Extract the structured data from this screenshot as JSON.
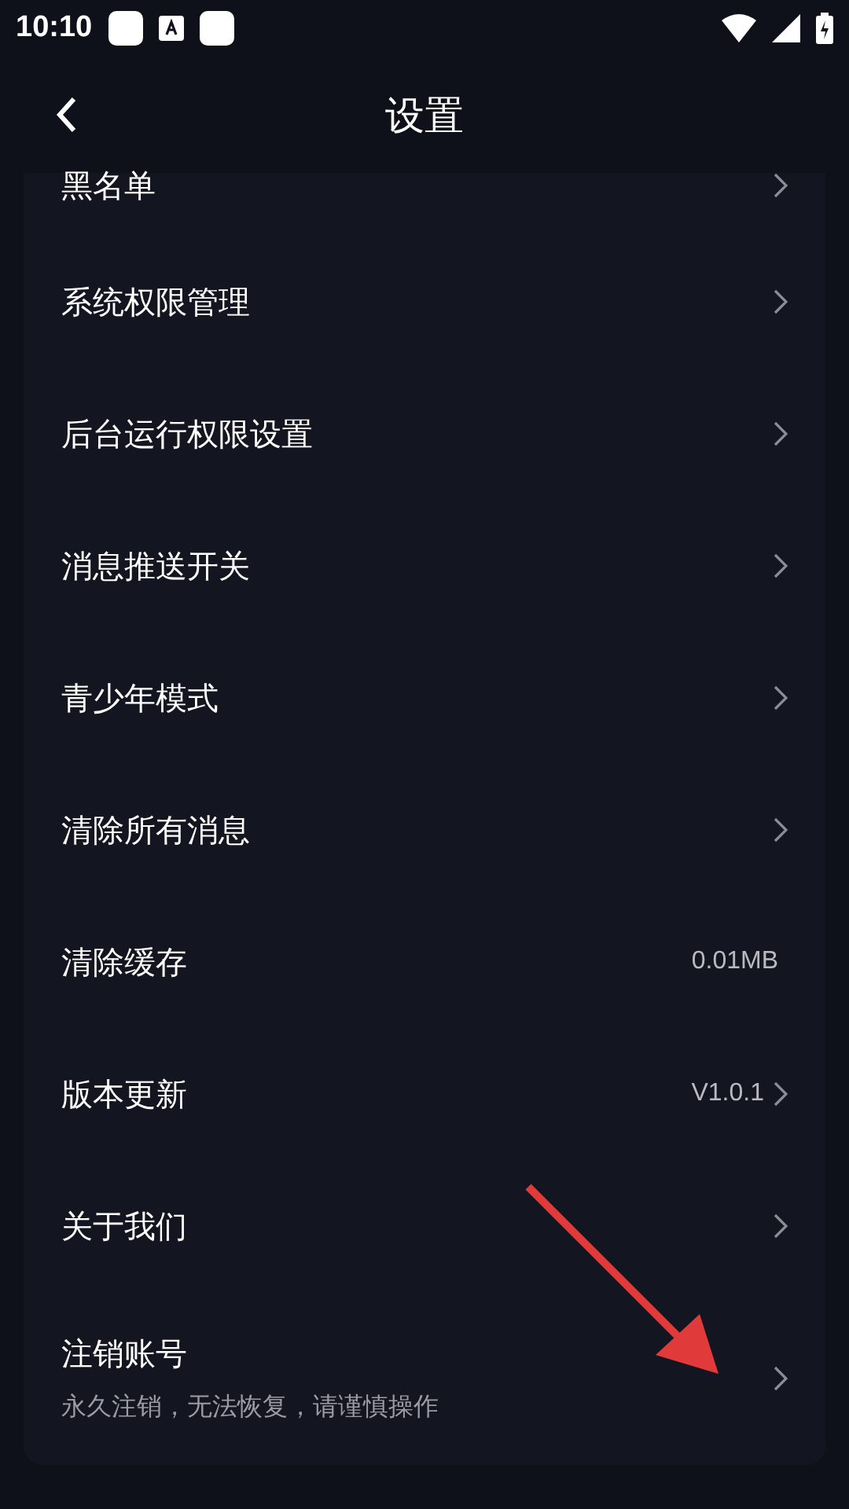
{
  "status_bar": {
    "time": "10:10"
  },
  "header": {
    "title": "设置"
  },
  "items": [
    {
      "label": "黑名单",
      "chevron": true,
      "partial": true
    },
    {
      "label": "系统权限管理",
      "chevron": true
    },
    {
      "label": "后台运行权限设置",
      "chevron": true
    },
    {
      "label": "消息推送开关",
      "chevron": true
    },
    {
      "label": "青少年模式",
      "chevron": true
    },
    {
      "label": "清除所有消息",
      "chevron": true
    },
    {
      "label": "清除缓存",
      "value": "0.01MB",
      "chevron": false
    },
    {
      "label": "版本更新",
      "value": "V1.0.1",
      "chevron": true
    },
    {
      "label": "关于我们",
      "chevron": true
    },
    {
      "label": "注销账号",
      "subtitle": "永久注销，无法恢复，请谨慎操作",
      "chevron": true
    }
  ]
}
